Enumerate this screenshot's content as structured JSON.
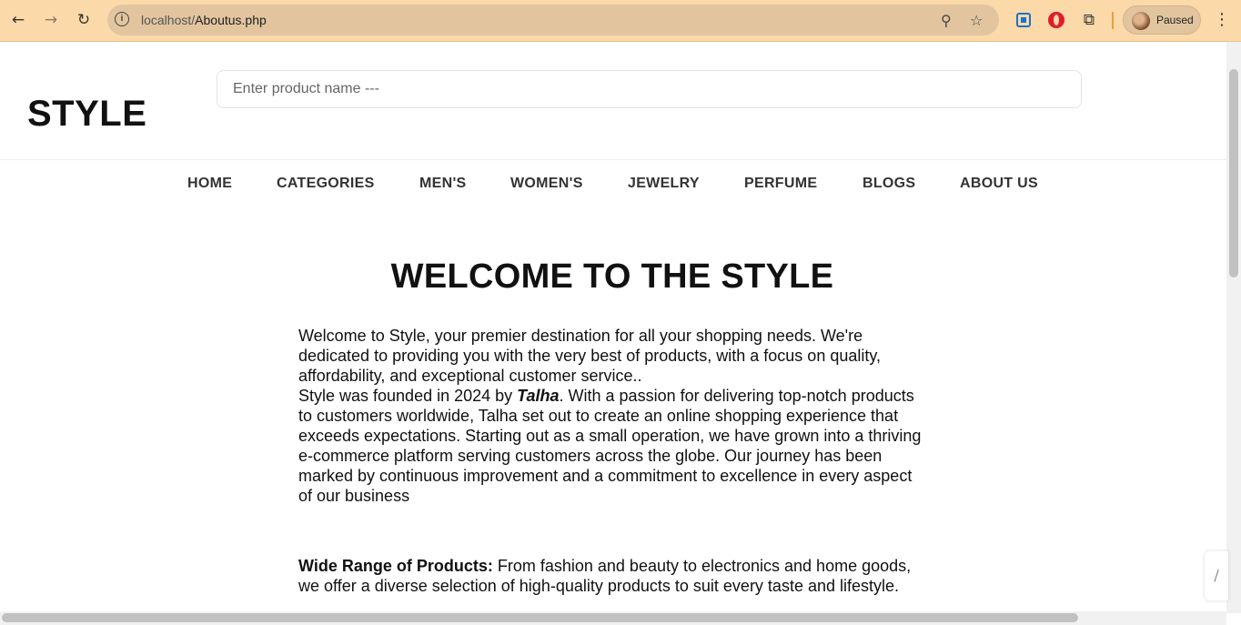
{
  "browser": {
    "url_host": "localhost/",
    "url_path": "Aboutus.php",
    "profile_status": "Paused",
    "icons": {
      "back": "arrow-left-icon",
      "forward": "arrow-right-icon",
      "reload": "reload-icon",
      "info": "info-icon",
      "zoom": "zoom-icon",
      "bookmark": "star-icon",
      "extension_1": "translate-extension-icon",
      "extension_2": "opera-extension-icon",
      "extensions": "puzzle-icon",
      "menu": "kebab-menu-icon"
    },
    "accent_color": "#fcd9a8"
  },
  "site": {
    "logo": "STYLE",
    "search_placeholder": "Enter product name ---",
    "nav": [
      "HOME",
      "CATEGORIES",
      "MEN'S",
      "WOMEN'S",
      "JEWELRY",
      "PERFUME",
      "BLOGS",
      "ABOUT US"
    ]
  },
  "about": {
    "heading": "WELCOME TO THE STYLE",
    "intro": "Welcome to Style, your premier destination for all your shopping needs. We're dedicated to providing you with the very best of products, with a focus on quality, affordability, and exceptional customer service..",
    "founded_prefix": "Style was founded in 2024 by ",
    "founder": "Talha",
    "founded_suffix": ". With a passion for delivering top-notch products to customers worldwide, Talha set out to create an online shopping experience that exceeds expectations. Starting out as a small operation, we have grown into a thriving e-commerce platform serving customers across the globe. Our journey has been marked by continuous improvement and a commitment to excellence in every aspect of our business",
    "feature_title": "Wide Range of Products:",
    "feature_text": " From fashion and beauty to electronics and home goods, we offer a diverse selection of high-quality products to suit every taste and lifestyle."
  }
}
